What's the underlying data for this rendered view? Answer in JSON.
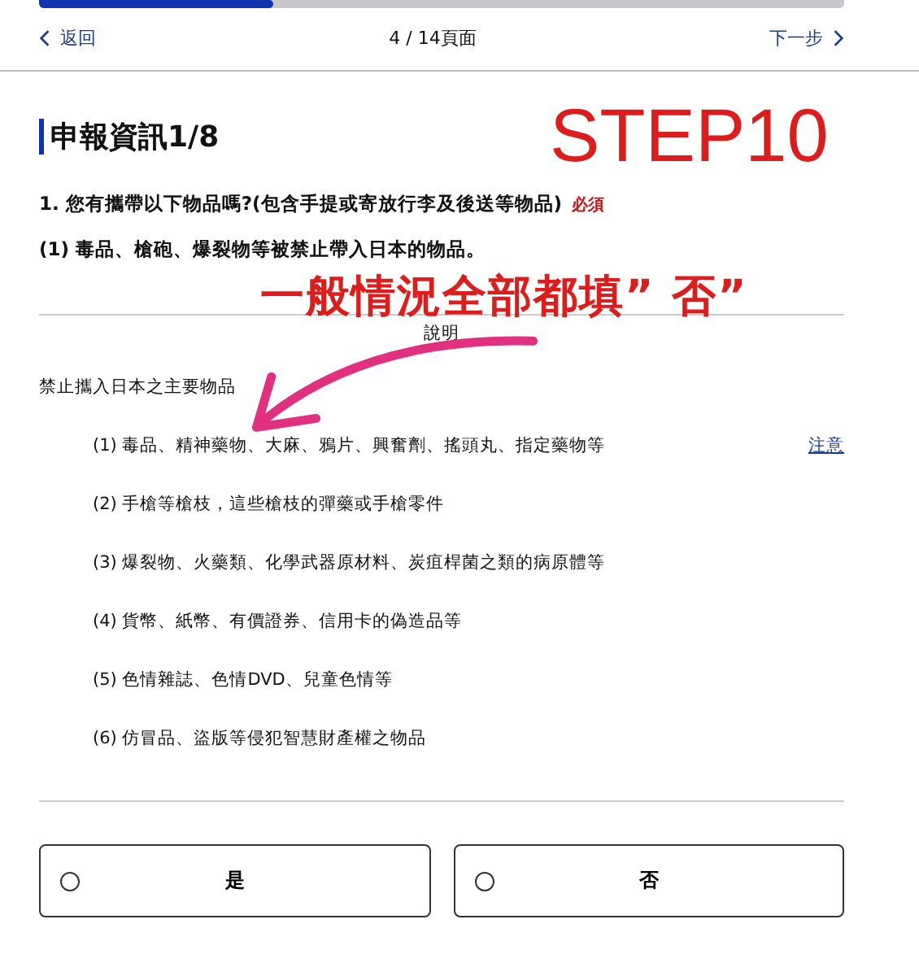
{
  "progress": {
    "level": 0.29
  },
  "nav": {
    "back": "返回",
    "page": "4 / 14頁面",
    "next": "下一步"
  },
  "section_title": "申報資訊1/8",
  "question": {
    "text": "1. 您有攜帶以下物品嗎?(包含手提或寄放行李及後送等物品)",
    "required": "必須"
  },
  "sub_question": "(1) 毒品、槍砲、爆裂物等被禁止帶入日本的物品。",
  "explanation": {
    "heading": "說明",
    "intro": "禁止攜入日本之主要物品",
    "items": [
      {
        "text": "(1) 毒品、精神藥物、大麻、鴉片、興奮劑、搖頭丸、指定藥物等",
        "link": "注意"
      },
      {
        "text": "(2) 手槍等槍枝，這些槍枝的彈藥或手槍零件"
      },
      {
        "text": "(3) 爆裂物、火藥類、化學武器原材料、炭疽桿菌之類的病原體等"
      },
      {
        "text": "(4) 貨幣、紙幣、有價證券、信用卡的偽造品等"
      },
      {
        "text": "(5) 色情雜誌、色情DVD、兒童色情等"
      },
      {
        "text": "(6) 仿冒品、盜版等侵犯智慧財產權之物品"
      }
    ]
  },
  "options": [
    {
      "label": "是",
      "selected": false
    },
    {
      "label": "否",
      "selected": false
    }
  ],
  "annotations": {
    "step": "STEP10",
    "note": "一般情況全部都填” 否”"
  }
}
